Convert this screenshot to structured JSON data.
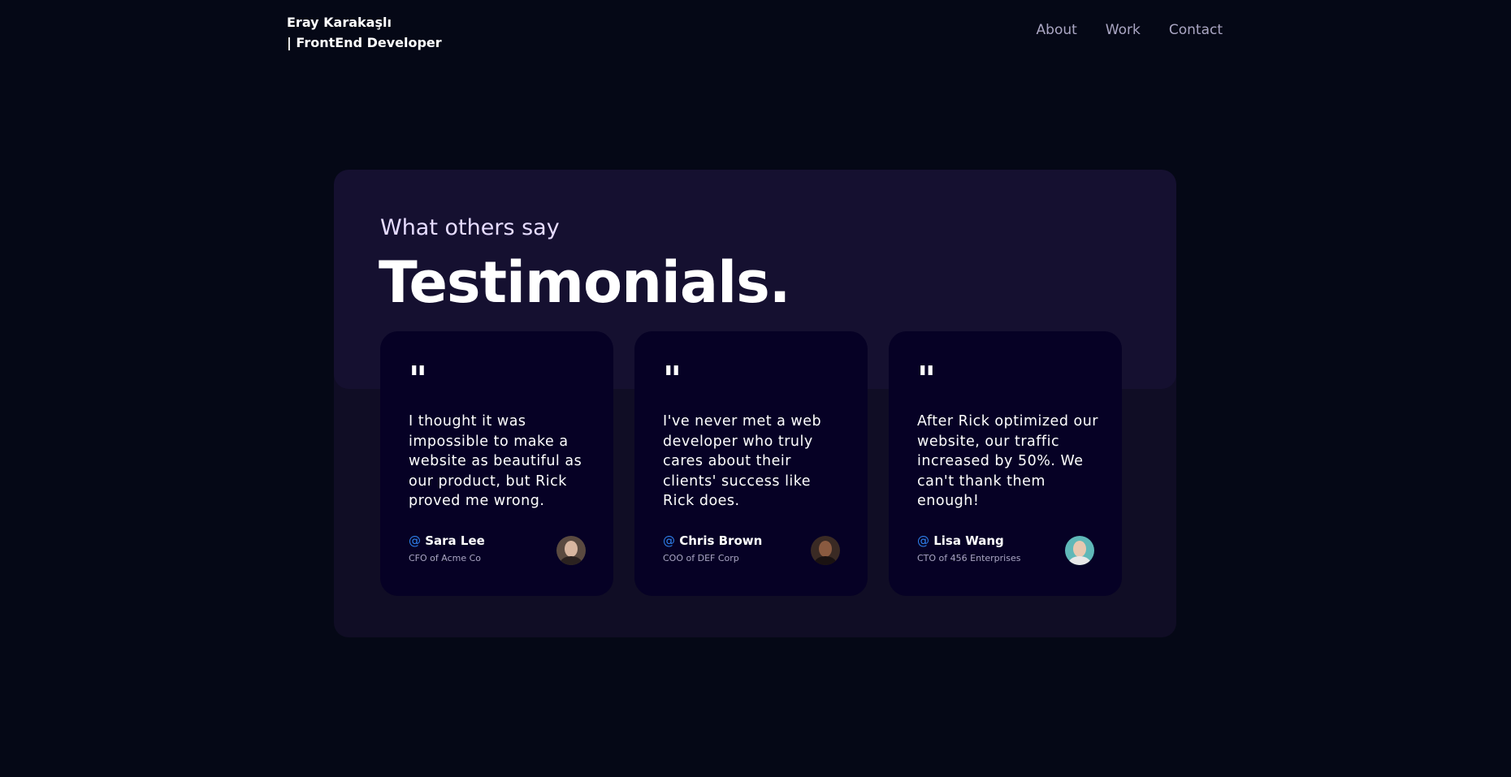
{
  "brand": {
    "line1": "Eray Karakaşlı",
    "line2": "| FrontEnd Developer"
  },
  "nav": {
    "items": [
      "About",
      "Work",
      "Contact"
    ]
  },
  "section": {
    "subtitle": "What others say",
    "title": "Testimonials."
  },
  "testimonials": [
    {
      "quote_mark": "\"",
      "text": "I thought it was impossible to make a website as beautiful as our product, but Rick proved me wrong.",
      "at": "@",
      "name": "Sara Lee",
      "role": "CFO of Acme Co"
    },
    {
      "quote_mark": "\"",
      "text": "I've never met a web developer who truly cares about their clients' success like Rick does.",
      "at": "@",
      "name": "Chris Brown",
      "role": "COO of DEF Corp"
    },
    {
      "quote_mark": "\"",
      "text": "After Rick optimized our website, our traffic increased by 50%. We can't thank them enough!",
      "at": "@",
      "name": "Lisa Wang",
      "role": "CTO of 456 Enterprises"
    }
  ],
  "colors": {
    "background": "#050816",
    "section_body": "#100d25",
    "section_head": "#151030",
    "card": "#060125",
    "secondary_text": "#aaa6c3",
    "accent_blue": "#2f80ed"
  }
}
